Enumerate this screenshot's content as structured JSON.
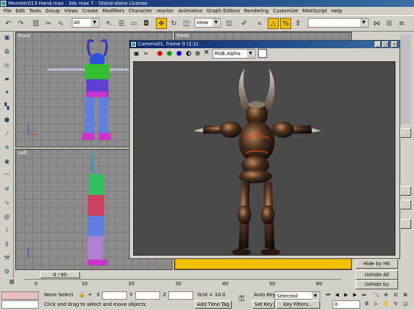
{
  "window": {
    "title": "Monster013-Hand.max - 3ds max 7 - Stand-alone License",
    "min_label": "_",
    "max_label": "□",
    "close_label": "×"
  },
  "menu": [
    "File",
    "Edit",
    "Tools",
    "Group",
    "Views",
    "Create",
    "Modifiers",
    "Character",
    "reactor",
    "Animation",
    "Graph Editors",
    "Rendering",
    "Customize",
    "MAXScript",
    "Help"
  ],
  "toolbar": {
    "selection_filter": "All",
    "coord_system": "View"
  },
  "viewports": {
    "front_label": "Front",
    "left_label": "Left",
    "top_right_label": "Front"
  },
  "render_frame": {
    "title": "Camera01, frame 0 (1:1)",
    "channel": "RGB Alpha",
    "channel_colors": {
      "red": "#e00000",
      "green": "#00a000",
      "blue": "#0000d0"
    }
  },
  "command_panel": {
    "unhide_all": "Unhide All",
    "unhide_by_name": "Unhide by Name...",
    "partial_button": "Hide by Hit"
  },
  "time_slider": {
    "position": "0 / 60",
    "progress": 0
  },
  "ruler": {
    "ticks": [
      "0",
      "10",
      "20",
      "30",
      "40",
      "50",
      "60"
    ]
  },
  "status": {
    "selection": "None Select",
    "x_label": "X",
    "y_label": "Y",
    "z_label": "Z",
    "grid": "Grid = 10.0",
    "prompt": "Click and drag to select and move objects",
    "add_time_tag": "Add Time Tag",
    "auto_key": "Auto Key",
    "auto_key_value": "Selected",
    "set_key": "Set Key",
    "key_filters": "Key Filters...",
    "frame_value": "0"
  },
  "colors": {
    "titlebar": "#0a246a",
    "accent": "#f2c200",
    "viewport_bg": "#8c8c8c",
    "render_bg": "#4a4a4a"
  }
}
